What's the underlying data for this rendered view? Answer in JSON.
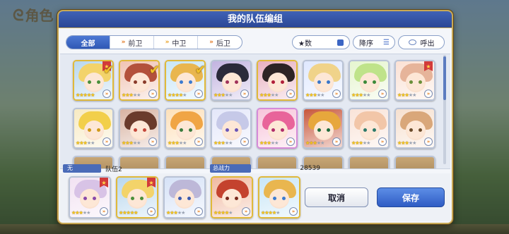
{
  "background": {
    "title": "角色"
  },
  "dialog": {
    "title": "我的队伍编组"
  },
  "filters": {
    "tabs": [
      {
        "label": "全部",
        "active": true,
        "icon": ""
      },
      {
        "label": "前卫",
        "active": false,
        "icon": "front-icon"
      },
      {
        "label": "中卫",
        "active": false,
        "icon": "middle-icon"
      },
      {
        "label": "后卫",
        "active": false,
        "icon": "back-icon"
      }
    ],
    "sort_key": "★数",
    "sort_order": "降序",
    "call_label": "呼出"
  },
  "roster": [
    {
      "hair": "#f3d36a",
      "bg": "#b8d7ee",
      "eye": "#4a8f3a",
      "frame": "gold",
      "stars": 5,
      "selected": true,
      "badge": true
    },
    {
      "hair": "#b3513c",
      "bg": "#f0c3b3",
      "eye": "#8a3b2a",
      "frame": "gold",
      "stars": 3,
      "selected": true,
      "badge": false
    },
    {
      "hair": "#e9b64f",
      "bg": "#c8e6f7",
      "eye": "#3c7bd0",
      "frame": "gold",
      "stars": 4,
      "selected": true,
      "badge": false
    },
    {
      "hair": "#2a2a3a",
      "bg": "#c2b3e0",
      "eye": "#a0325a",
      "frame": "silver",
      "stars": 3,
      "selected": false,
      "badge": false
    },
    {
      "hair": "#2c2424",
      "bg": "#e7b0c0",
      "eye": "#b01e3a",
      "frame": "gold",
      "stars": 3,
      "selected": false,
      "badge": false
    },
    {
      "hair": "#f0d38a",
      "bg": "#dfe8ff",
      "eye": "#3a76c9",
      "frame": "silver",
      "stars": 3,
      "selected": false,
      "badge": false
    },
    {
      "hair": "#bfe38a",
      "bg": "#e6f5cf",
      "eye": "#3c8a3a",
      "frame": "silver",
      "stars": 3,
      "selected": false,
      "badge": false
    },
    {
      "hair": "#e6b49a",
      "bg": "#fbe1d4",
      "eye": "#6a8f3a",
      "frame": "silver",
      "stars": 3,
      "selected": false,
      "badge": true
    },
    {
      "hair": "#f2cf4a",
      "bg": "#f7eac2",
      "eye": "#d09a1a",
      "frame": "silver",
      "stars": 3,
      "selected": false,
      "badge": false
    },
    {
      "hair": "#6a3b2c",
      "bg": "#d8b3a2",
      "eye": "#c4473a",
      "frame": "silver",
      "stars": 3,
      "selected": false,
      "badge": false
    },
    {
      "hair": "#f0a545",
      "bg": "#fde0b9",
      "eye": "#3a7a3c",
      "frame": "silver",
      "stars": 3,
      "selected": false,
      "badge": false
    },
    {
      "hair": "#c6c9e8",
      "bg": "#e4e7fa",
      "eye": "#6a56b8",
      "frame": "silver",
      "stars": 3,
      "selected": false,
      "badge": false
    },
    {
      "hair": "#e8649a",
      "bg": "#f7c4da",
      "eye": "#b02c6a",
      "frame": "rainbow",
      "stars": 3,
      "selected": false,
      "badge": false
    },
    {
      "hair": "#e7a73c",
      "bg": "#c7563b",
      "eye": "#1e6b3a",
      "frame": "silver",
      "stars": 3,
      "selected": false,
      "badge": false
    },
    {
      "hair": "#f2c6a8",
      "bg": "#f9e3d8",
      "eye": "#2d7a6a",
      "frame": "silver",
      "stars": 3,
      "selected": false,
      "badge": false
    },
    {
      "hair": "#d9a77a",
      "bg": "#f6e0cf",
      "eye": "#6a4a2a",
      "frame": "silver",
      "stars": 3,
      "selected": false,
      "badge": false
    }
  ],
  "team": {
    "slot_label": "无",
    "name": "队伍2",
    "power_label": "总战力",
    "power_value": "28539",
    "members": [
      {
        "hair": "#d8c3e6",
        "bg": "#f2e2f2",
        "eye": "#8a4aa8",
        "frame": "silver",
        "stars": 3,
        "badge": true
      },
      {
        "hair": "#f3d36a",
        "bg": "#b8d7ee",
        "eye": "#4a8f3a",
        "frame": "gold",
        "stars": 5,
        "badge": true
      },
      {
        "hair": "#bdb8d8",
        "bg": "#d6e2f7",
        "eye": "#3a5ab0",
        "frame": "silver",
        "stars": 3,
        "badge": false
      },
      {
        "hair": "#c4422e",
        "bg": "#f0b9a1",
        "eye": "#7a2a1e",
        "frame": "gold",
        "stars": 4,
        "badge": false
      },
      {
        "hair": "#e9b64f",
        "bg": "#c8e6f7",
        "eye": "#3c7bd0",
        "frame": "gold",
        "stars": 4,
        "badge": false
      }
    ]
  },
  "buttons": {
    "cancel": "取消",
    "save": "保存"
  },
  "colors": {
    "accent": "#2f58b5",
    "gold": "#e0b93a",
    "header": "#3f62b6"
  }
}
